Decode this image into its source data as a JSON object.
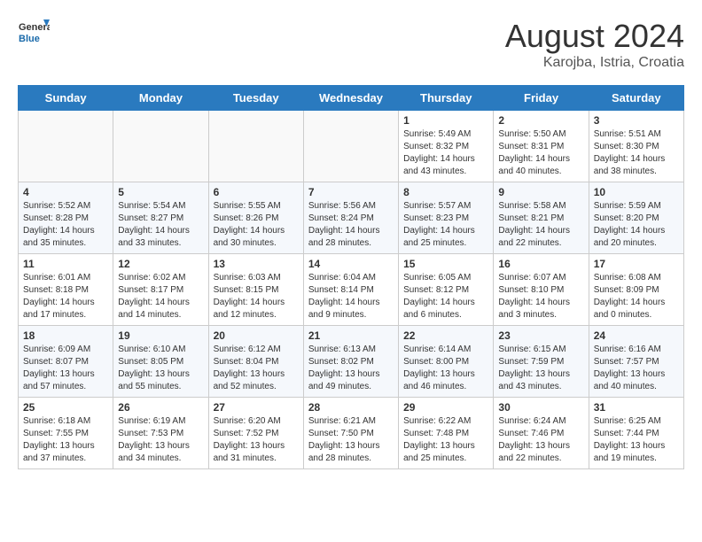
{
  "header": {
    "logo_general": "General",
    "logo_blue": "Blue",
    "month": "August 2024",
    "location": "Karojba, Istria, Croatia"
  },
  "weekdays": [
    "Sunday",
    "Monday",
    "Tuesday",
    "Wednesday",
    "Thursday",
    "Friday",
    "Saturday"
  ],
  "weeks": [
    [
      {
        "day": "",
        "info": ""
      },
      {
        "day": "",
        "info": ""
      },
      {
        "day": "",
        "info": ""
      },
      {
        "day": "",
        "info": ""
      },
      {
        "day": "1",
        "info": "Sunrise: 5:49 AM\nSunset: 8:32 PM\nDaylight: 14 hours\nand 43 minutes."
      },
      {
        "day": "2",
        "info": "Sunrise: 5:50 AM\nSunset: 8:31 PM\nDaylight: 14 hours\nand 40 minutes."
      },
      {
        "day": "3",
        "info": "Sunrise: 5:51 AM\nSunset: 8:30 PM\nDaylight: 14 hours\nand 38 minutes."
      }
    ],
    [
      {
        "day": "4",
        "info": "Sunrise: 5:52 AM\nSunset: 8:28 PM\nDaylight: 14 hours\nand 35 minutes."
      },
      {
        "day": "5",
        "info": "Sunrise: 5:54 AM\nSunset: 8:27 PM\nDaylight: 14 hours\nand 33 minutes."
      },
      {
        "day": "6",
        "info": "Sunrise: 5:55 AM\nSunset: 8:26 PM\nDaylight: 14 hours\nand 30 minutes."
      },
      {
        "day": "7",
        "info": "Sunrise: 5:56 AM\nSunset: 8:24 PM\nDaylight: 14 hours\nand 28 minutes."
      },
      {
        "day": "8",
        "info": "Sunrise: 5:57 AM\nSunset: 8:23 PM\nDaylight: 14 hours\nand 25 minutes."
      },
      {
        "day": "9",
        "info": "Sunrise: 5:58 AM\nSunset: 8:21 PM\nDaylight: 14 hours\nand 22 minutes."
      },
      {
        "day": "10",
        "info": "Sunrise: 5:59 AM\nSunset: 8:20 PM\nDaylight: 14 hours\nand 20 minutes."
      }
    ],
    [
      {
        "day": "11",
        "info": "Sunrise: 6:01 AM\nSunset: 8:18 PM\nDaylight: 14 hours\nand 17 minutes."
      },
      {
        "day": "12",
        "info": "Sunrise: 6:02 AM\nSunset: 8:17 PM\nDaylight: 14 hours\nand 14 minutes."
      },
      {
        "day": "13",
        "info": "Sunrise: 6:03 AM\nSunset: 8:15 PM\nDaylight: 14 hours\nand 12 minutes."
      },
      {
        "day": "14",
        "info": "Sunrise: 6:04 AM\nSunset: 8:14 PM\nDaylight: 14 hours\nand 9 minutes."
      },
      {
        "day": "15",
        "info": "Sunrise: 6:05 AM\nSunset: 8:12 PM\nDaylight: 14 hours\nand 6 minutes."
      },
      {
        "day": "16",
        "info": "Sunrise: 6:07 AM\nSunset: 8:10 PM\nDaylight: 14 hours\nand 3 minutes."
      },
      {
        "day": "17",
        "info": "Sunrise: 6:08 AM\nSunset: 8:09 PM\nDaylight: 14 hours\nand 0 minutes."
      }
    ],
    [
      {
        "day": "18",
        "info": "Sunrise: 6:09 AM\nSunset: 8:07 PM\nDaylight: 13 hours\nand 57 minutes."
      },
      {
        "day": "19",
        "info": "Sunrise: 6:10 AM\nSunset: 8:05 PM\nDaylight: 13 hours\nand 55 minutes."
      },
      {
        "day": "20",
        "info": "Sunrise: 6:12 AM\nSunset: 8:04 PM\nDaylight: 13 hours\nand 52 minutes."
      },
      {
        "day": "21",
        "info": "Sunrise: 6:13 AM\nSunset: 8:02 PM\nDaylight: 13 hours\nand 49 minutes."
      },
      {
        "day": "22",
        "info": "Sunrise: 6:14 AM\nSunset: 8:00 PM\nDaylight: 13 hours\nand 46 minutes."
      },
      {
        "day": "23",
        "info": "Sunrise: 6:15 AM\nSunset: 7:59 PM\nDaylight: 13 hours\nand 43 minutes."
      },
      {
        "day": "24",
        "info": "Sunrise: 6:16 AM\nSunset: 7:57 PM\nDaylight: 13 hours\nand 40 minutes."
      }
    ],
    [
      {
        "day": "25",
        "info": "Sunrise: 6:18 AM\nSunset: 7:55 PM\nDaylight: 13 hours\nand 37 minutes."
      },
      {
        "day": "26",
        "info": "Sunrise: 6:19 AM\nSunset: 7:53 PM\nDaylight: 13 hours\nand 34 minutes."
      },
      {
        "day": "27",
        "info": "Sunrise: 6:20 AM\nSunset: 7:52 PM\nDaylight: 13 hours\nand 31 minutes."
      },
      {
        "day": "28",
        "info": "Sunrise: 6:21 AM\nSunset: 7:50 PM\nDaylight: 13 hours\nand 28 minutes."
      },
      {
        "day": "29",
        "info": "Sunrise: 6:22 AM\nSunset: 7:48 PM\nDaylight: 13 hours\nand 25 minutes."
      },
      {
        "day": "30",
        "info": "Sunrise: 6:24 AM\nSunset: 7:46 PM\nDaylight: 13 hours\nand 22 minutes."
      },
      {
        "day": "31",
        "info": "Sunrise: 6:25 AM\nSunset: 7:44 PM\nDaylight: 13 hours\nand 19 minutes."
      }
    ]
  ]
}
